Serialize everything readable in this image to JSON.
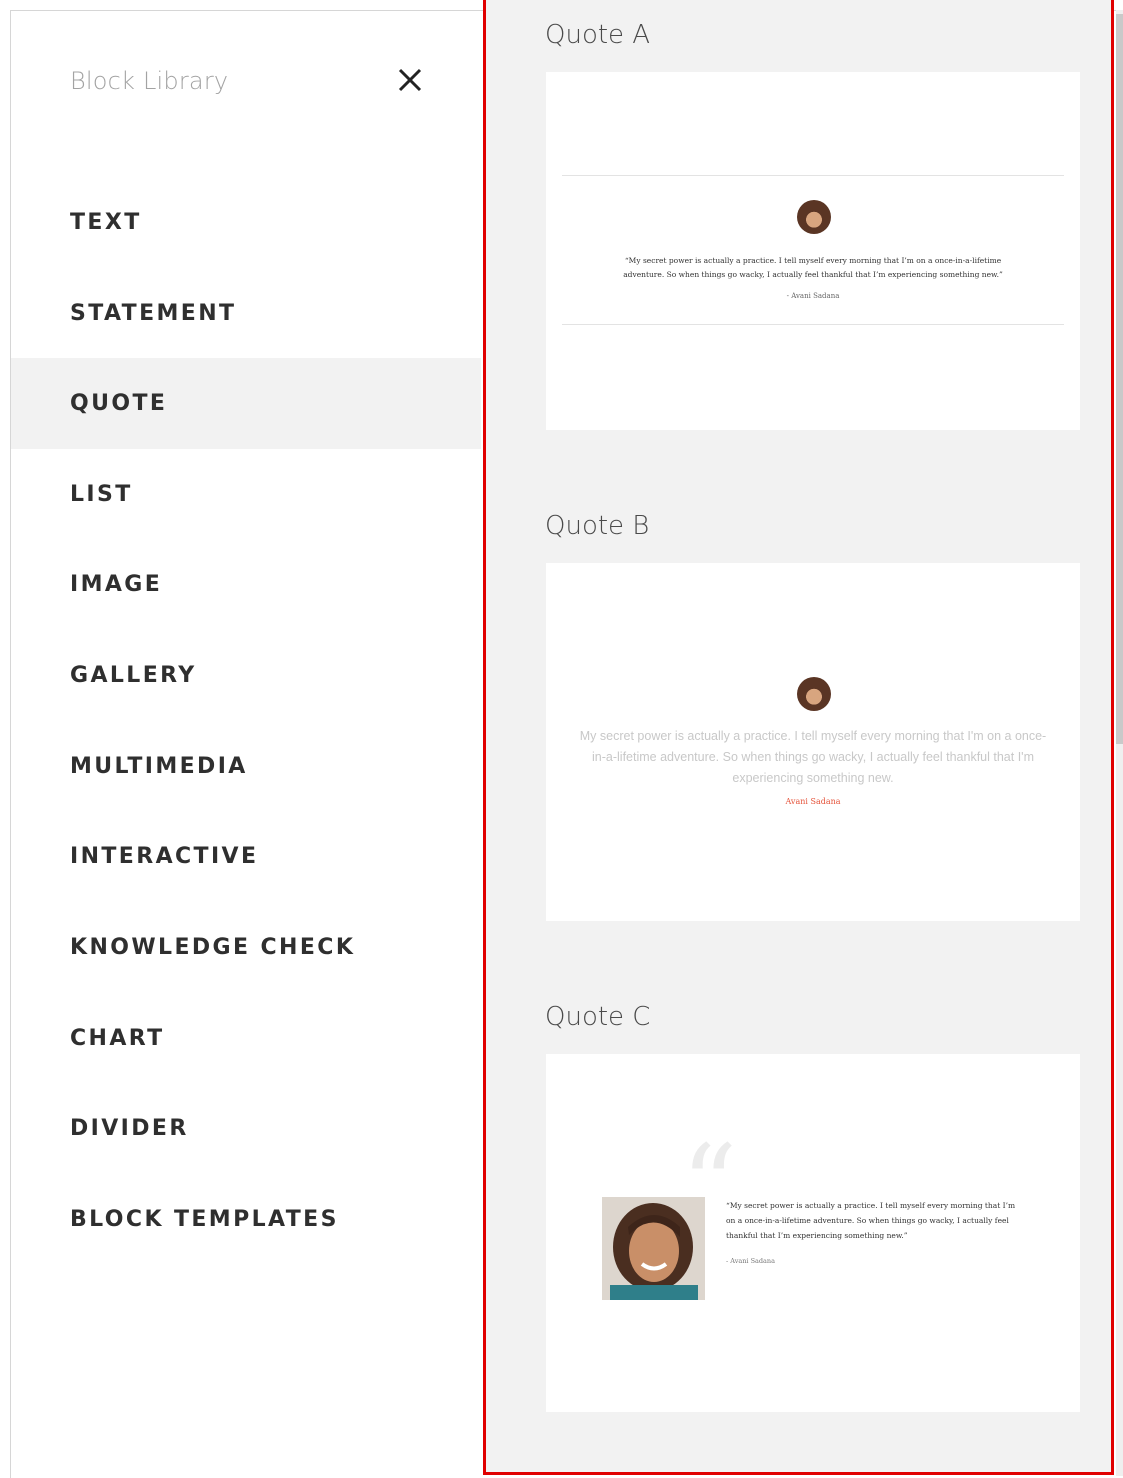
{
  "sidebar": {
    "title": "Block Library",
    "close_icon": "close-icon",
    "items": [
      {
        "label": "TEXT"
      },
      {
        "label": "STATEMENT"
      },
      {
        "label": "QUOTE"
      },
      {
        "label": "LIST"
      },
      {
        "label": "IMAGE"
      },
      {
        "label": "GALLERY"
      },
      {
        "label": "MULTIMEDIA"
      },
      {
        "label": "INTERACTIVE"
      },
      {
        "label": "KNOWLEDGE CHECK"
      },
      {
        "label": "CHART"
      },
      {
        "label": "DIVIDER"
      },
      {
        "label": "BLOCK TEMPLATES"
      }
    ],
    "active_item": "QUOTE"
  },
  "templates": [
    {
      "title": "Quote A",
      "quote": "“My secret power is actually a practice. I tell myself every morning that I’m on a once-in-a-lifetime adventure. So when things go wacky, I actually feel thankful that I’m experiencing something new.”",
      "author": "- Avani Sadana"
    },
    {
      "title": "Quote B",
      "quote": "My secret power is actually a practice. I tell myself every morning that I'm on a once-in-a-lifetime adventure. So when things go wacky, I actually feel thankful that I'm experiencing something new.",
      "author": "Avani Sadana"
    },
    {
      "title": "Quote C",
      "quote": "“My secret power is actually a practice. I tell myself every morning that I’m on a once-in-a-lifetime adventure. So when things go wacky, I actually feel thankful that I’m experiencing something new.”",
      "author": "- Avani Sadana",
      "quote_mark": "“"
    }
  ],
  "colors": {
    "highlight_border": "#e00000",
    "panel_background": "#f2f2f2",
    "active_nav_background": "#f2f2f2",
    "quote_b_author": "#e5533a"
  }
}
